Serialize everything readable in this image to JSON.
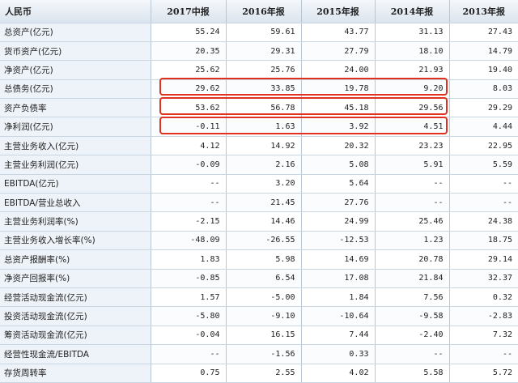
{
  "table": {
    "header": [
      "人民币",
      "2017中报",
      "2016年报",
      "2015年报",
      "2014年报",
      "2013年报"
    ],
    "rows": [
      {
        "label": "总资产(亿元)",
        "values": [
          "55.24",
          "59.61",
          "43.77",
          "31.13",
          "27.43"
        ]
      },
      {
        "label": "货币资产(亿元)",
        "values": [
          "20.35",
          "29.31",
          "27.79",
          "18.10",
          "14.79"
        ]
      },
      {
        "label": "净资产(亿元)",
        "values": [
          "25.62",
          "25.76",
          "24.00",
          "21.93",
          "19.40"
        ]
      },
      {
        "label": "总债务(亿元)",
        "values": [
          "29.62",
          "33.85",
          "19.78",
          "9.20",
          "8.03"
        ]
      },
      {
        "label": "资产负债率",
        "values": [
          "53.62",
          "56.78",
          "45.18",
          "29.56",
          "29.29"
        ]
      },
      {
        "label": "净利润(亿元)",
        "values": [
          "-0.11",
          "1.63",
          "3.92",
          "4.51",
          "4.44"
        ]
      },
      {
        "label": "主营业务收入(亿元)",
        "values": [
          "4.12",
          "14.92",
          "20.32",
          "23.23",
          "22.95"
        ]
      },
      {
        "label": "主营业务利润(亿元)",
        "values": [
          "-0.09",
          "2.16",
          "5.08",
          "5.91",
          "5.59"
        ]
      },
      {
        "label": "EBITDA(亿元)",
        "values": [
          "--",
          "3.20",
          "5.64",
          "--",
          "--"
        ]
      },
      {
        "label": "EBITDA/营业总收入",
        "values": [
          "--",
          "21.45",
          "27.76",
          "--",
          "--"
        ]
      },
      {
        "label": "主营业务利润率(%)",
        "values": [
          "-2.15",
          "14.46",
          "24.99",
          "25.46",
          "24.38"
        ]
      },
      {
        "label": "主营业务收入增长率(%)",
        "values": [
          "-48.09",
          "-26.55",
          "-12.53",
          "1.23",
          "18.75"
        ]
      },
      {
        "label": "总资产报酬率(%)",
        "values": [
          "1.83",
          "5.98",
          "14.69",
          "20.78",
          "29.14"
        ]
      },
      {
        "label": "净资产回报率(%)",
        "values": [
          "-0.85",
          "6.54",
          "17.08",
          "21.84",
          "32.37"
        ]
      },
      {
        "label": "经营活动现金流(亿元)",
        "values": [
          "1.57",
          "-5.00",
          "1.84",
          "7.56",
          "0.32"
        ]
      },
      {
        "label": "投资活动现金流(亿元)",
        "values": [
          "-5.80",
          "-9.10",
          "-10.64",
          "-9.58",
          "-2.83"
        ]
      },
      {
        "label": "筹资活动现金流(亿元)",
        "values": [
          "-0.04",
          "16.15",
          "7.44",
          "-2.40",
          "7.32"
        ]
      },
      {
        "label": "经营性现金流/EBITDA",
        "values": [
          "--",
          "-1.56",
          "0.33",
          "--",
          "--"
        ]
      },
      {
        "label": "存货周转率",
        "values": [
          "0.75",
          "2.55",
          "4.02",
          "5.58",
          "5.72"
        ]
      }
    ]
  },
  "highlight_color": "#e0301e"
}
